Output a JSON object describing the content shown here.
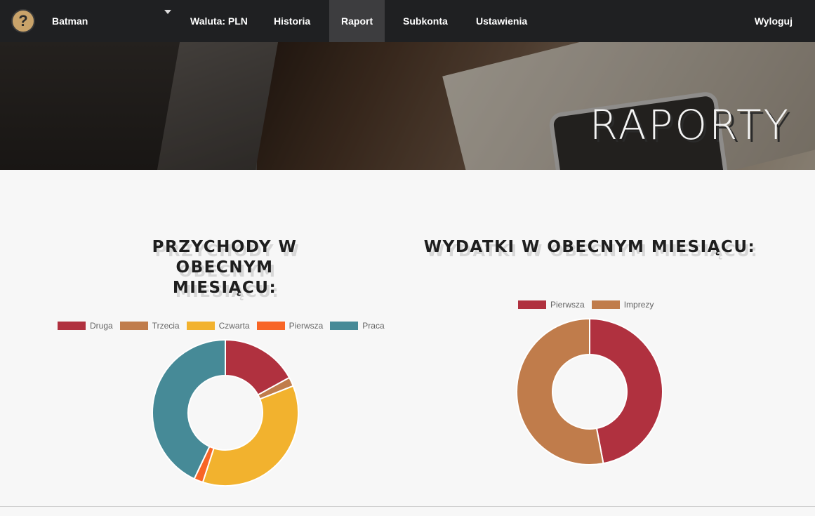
{
  "nav": {
    "user": "Batman",
    "links": [
      "Waluta: PLN",
      "Historia",
      "Raport",
      "Subkonta",
      "Ustawienia"
    ],
    "active": "Raport",
    "logout": "Wyloguj"
  },
  "hero": {
    "title": "RAPORTY"
  },
  "income": {
    "title_line1": "PRZYCHODY W OBECNYM",
    "title_line2": "MIESIĄCU:"
  },
  "expenses": {
    "title": "WYDATKI W OBECNYM MIESIĄCU:"
  },
  "colors": {
    "Druga": "#b0313f",
    "Trzecia": "#c07c4b",
    "Czwarta": "#f2b22e",
    "Pierwsza_income": "#f86526",
    "Praca": "#468a97",
    "Pierwsza_expense": "#b0313f",
    "Imprezy": "#c07c4b"
  },
  "chart_data": [
    {
      "type": "pie",
      "labels": [
        "Druga",
        "Trzecia",
        "Czwarta",
        "Pierwsza",
        "Praca"
      ],
      "values": [
        17,
        2,
        36,
        2,
        43
      ],
      "colors": [
        "#b0313f",
        "#c07c4b",
        "#f2b22e",
        "#f86526",
        "#468a97"
      ]
    },
    {
      "type": "pie",
      "labels": [
        "Pierwsza",
        "Imprezy"
      ],
      "values": [
        47,
        53
      ],
      "colors": [
        "#b0313f",
        "#c07c4b"
      ]
    }
  ]
}
